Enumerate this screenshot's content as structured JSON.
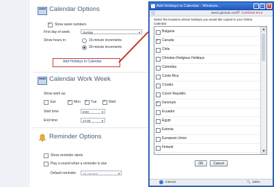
{
  "options": {
    "calendar_options_title": "Calendar Options",
    "show_week_numbers": "Show week numbers",
    "first_day_label": "First day of week:",
    "first_day_value": "Sunday",
    "show_hours_label": "Show hours in:",
    "hours_15": "15-minute increments",
    "hours_30": "30-minute increments",
    "add_holidays_link": "Add Holidays to Calendar",
    "work_week_title": "Calendar Work Week",
    "show_work_as": "Show work as:",
    "days": [
      "Sun",
      "Mon",
      "Tue",
      "Wed"
    ],
    "start_time_label": "Start time:",
    "start_time_value": "8:00",
    "end_time_label": "End time:",
    "end_time_value": "17:00",
    "reminder_title": "Reminder Options",
    "show_reminder_alerts": "Show reminder alerts",
    "play_sound": "Play a sound when a reminder is due",
    "default_reminder_label": "Default reminder:",
    "default_reminder_value": "15 minutes"
  },
  "dialog": {
    "title": "Add Holidays to Calendar - Windows...",
    "address": "wwsz.ganman.com",
    "cert_error": "Certificate Error",
    "prompt": "Select the locations whose holidays you would like copied to your Online Calendar:",
    "locations": [
      {
        "name": "Bulgaria",
        "checked": false
      },
      {
        "name": "Canada",
        "checked": true
      },
      {
        "name": "Chile",
        "checked": false
      },
      {
        "name": "Christian Religious Holidays",
        "checked": false
      },
      {
        "name": "Colombia",
        "checked": false
      },
      {
        "name": "Costa Rica",
        "checked": false
      },
      {
        "name": "Croatia",
        "checked": false
      },
      {
        "name": "Czech Republic",
        "checked": false
      },
      {
        "name": "Denmark",
        "checked": true
      },
      {
        "name": "Ecuador",
        "checked": false
      },
      {
        "name": "Egypt",
        "checked": false
      },
      {
        "name": "Estonia",
        "checked": false
      },
      {
        "name": "European Union",
        "checked": false
      },
      {
        "name": "Finland",
        "checked": false
      }
    ],
    "ok_label": "OK",
    "cancel_label": "Cancel",
    "status_zone": "Internet",
    "zoom": "100%"
  },
  "colors": {
    "accent": "#2e5fb3",
    "link_box": "#c0392b"
  }
}
